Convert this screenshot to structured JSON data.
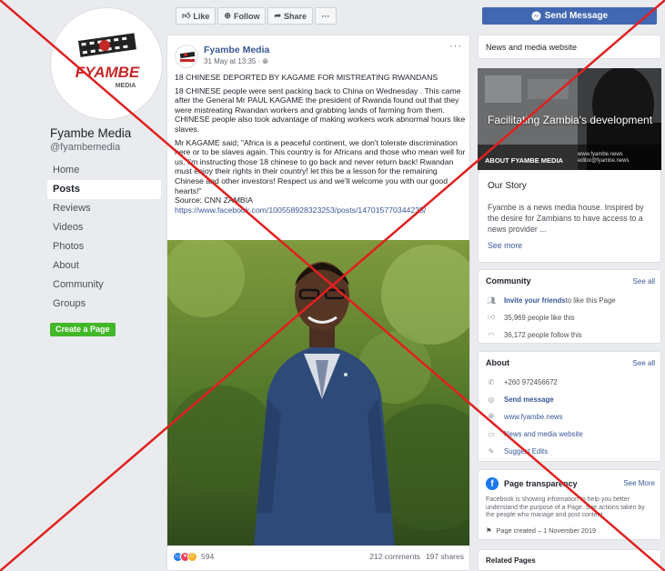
{
  "page": {
    "name": "Fyambe Media",
    "handle": "@fyambemedia",
    "logo_text": "FYAMBE",
    "logo_subtext": "MEDIA"
  },
  "nav": {
    "items": [
      {
        "label": "Home",
        "active": false
      },
      {
        "label": "Posts",
        "active": true
      },
      {
        "label": "Reviews",
        "active": false
      },
      {
        "label": "Videos",
        "active": false
      },
      {
        "label": "Photos",
        "active": false
      },
      {
        "label": "About",
        "active": false
      },
      {
        "label": "Community",
        "active": false
      },
      {
        "label": "Groups",
        "active": false
      }
    ],
    "create_page": "Create a Page"
  },
  "actions": {
    "like": "Like",
    "follow": "Follow",
    "share": "Share",
    "more": "···",
    "send_message": "Send Message"
  },
  "post": {
    "author": "Fyambe Media",
    "time": "31 May at 13:35 · ",
    "menu": "···",
    "headline": "18 CHINESE DEPORTED BY KAGAME FOR MISTREATING RWANDANS",
    "para1": "18 CHINESE people were sent packing back to China on Wednesday . This came after the General Mr PAUL KAGAME the president of Rwanda found out that they were mistreating Rwandan workers and grabbing lands of farming from them. CHINESE people also took advantage of making workers work abnormal hours like slaves.",
    "para2": "Mr KAGAME said; \"Africa is a peaceful continent, we don't tolerate discrimination here or to be slaves again. This country is for Africans and those who mean well for us. I'm instructing those 18 chinese to go back and never return back! Rwandan must enjoy their rights in their country! let this be a lesson for the remaining Chinese and other investors! Respect us and we'll welcome you with our good hearts!\"",
    "source": "Source: CNN ZAMBIA",
    "link": "https://www.facebook.com/100558928323253/posts/147015770344235/",
    "reaction_count": "594",
    "comments": "212 comments",
    "shares": "197 shares"
  },
  "sidebar": {
    "category": "News and media website",
    "cover_title": "Facilitating Zambia's development",
    "cover_caption": "ABOUT FYAMBE MEDIA",
    "cover_site_1": "www.fyambe.news",
    "cover_site_2": "editor@fyambe.news",
    "story_title": "Our Story",
    "story_text": "Fyambe is a news media house. Inspired by the desire for Zambians to have access to a news provider ...",
    "story_more": "See more",
    "community": {
      "title": "Community",
      "see_all": "See all",
      "invite_link": "Invite your friends",
      "invite_rest": " to like this Page",
      "likes": "35,969 people like this",
      "follows": "36,172 people follow this"
    },
    "about": {
      "title": "About",
      "see_all": "See all",
      "phone": "+260 972456672",
      "send_message": "Send message",
      "website": "www.fyambe.news",
      "category": "News and media website",
      "suggest": "Suggest Edits"
    },
    "transparency": {
      "title": "Page transparency",
      "see_more": "See More",
      "text": "Facebook is showing information to help you better understand the purpose of a Page. See actions taken by the people who manage and post content.",
      "created": "Page created – 1 November 2019"
    },
    "related": "Related Pages"
  },
  "colors": {
    "facebook_blue": "#4267b2",
    "link_blue": "#385898",
    "create_green": "#42b72a",
    "cross_red": "#e02020"
  }
}
